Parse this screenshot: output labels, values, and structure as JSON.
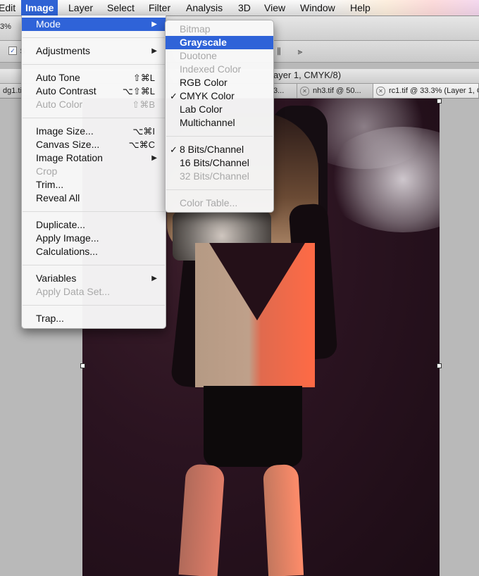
{
  "menubar": {
    "items": [
      "Edit",
      "Image",
      "Layer",
      "Select",
      "Filter",
      "Analysis",
      "3D",
      "View",
      "Window",
      "Help"
    ]
  },
  "toolbar": {
    "zoom": "3%",
    "checkbox_label": "S"
  },
  "document": {
    "title": "ayer 1, CMYK/8)"
  },
  "tabs": [
    {
      "label": "dg1.ti"
    },
    {
      "label": "3..."
    },
    {
      "label": "nh3.tif @ 50..."
    },
    {
      "label": "rc1.tif @ 33.3% (Layer 1, C"
    }
  ],
  "image_menu": {
    "items": [
      {
        "label": "Mode",
        "shortcut": "",
        "submenu": true,
        "enabled": true,
        "highlighted": true
      },
      {
        "label": "Adjustments",
        "shortcut": "",
        "submenu": true,
        "enabled": true
      },
      {
        "label": "Auto Tone",
        "shortcut": "⇧⌘L",
        "enabled": true
      },
      {
        "label": "Auto Contrast",
        "shortcut": "⌥⇧⌘L",
        "enabled": true
      },
      {
        "label": "Auto Color",
        "shortcut": "⇧⌘B",
        "enabled": false
      },
      {
        "label": "Image Size...",
        "shortcut": "⌥⌘I",
        "enabled": true
      },
      {
        "label": "Canvas Size...",
        "shortcut": "⌥⌘C",
        "enabled": true
      },
      {
        "label": "Image Rotation",
        "shortcut": "",
        "submenu": true,
        "enabled": true
      },
      {
        "label": "Crop",
        "shortcut": "",
        "enabled": false
      },
      {
        "label": "Trim...",
        "shortcut": "",
        "enabled": true
      },
      {
        "label": "Reveal All",
        "shortcut": "",
        "enabled": true
      },
      {
        "label": "Duplicate...",
        "shortcut": "",
        "enabled": true
      },
      {
        "label": "Apply Image...",
        "shortcut": "",
        "enabled": true
      },
      {
        "label": "Calculations...",
        "shortcut": "",
        "enabled": true
      },
      {
        "label": "Variables",
        "shortcut": "",
        "submenu": true,
        "enabled": true
      },
      {
        "label": "Apply Data Set...",
        "shortcut": "",
        "enabled": false
      },
      {
        "label": "Trap...",
        "shortcut": "",
        "enabled": true
      }
    ]
  },
  "mode_submenu": {
    "items": [
      {
        "label": "Bitmap",
        "enabled": false
      },
      {
        "label": "Grayscale",
        "enabled": true,
        "highlighted": true
      },
      {
        "label": "Duotone",
        "enabled": false
      },
      {
        "label": "Indexed Color",
        "enabled": false
      },
      {
        "label": "RGB Color",
        "enabled": true
      },
      {
        "label": "CMYK Color",
        "enabled": true,
        "checked": true
      },
      {
        "label": "Lab Color",
        "enabled": true
      },
      {
        "label": "Multichannel",
        "enabled": true
      },
      {
        "label": "8 Bits/Channel",
        "enabled": true,
        "checked": true
      },
      {
        "label": "16 Bits/Channel",
        "enabled": true
      },
      {
        "label": "32 Bits/Channel",
        "enabled": false
      },
      {
        "label": "Color Table...",
        "enabled": false
      }
    ]
  },
  "icons": {
    "checkmark": "✓",
    "submenu_arrow": "▶",
    "tab_close": "✕"
  },
  "colors": {
    "highlight": "#2f63d8",
    "disabled_text": "#a8a8a8"
  }
}
